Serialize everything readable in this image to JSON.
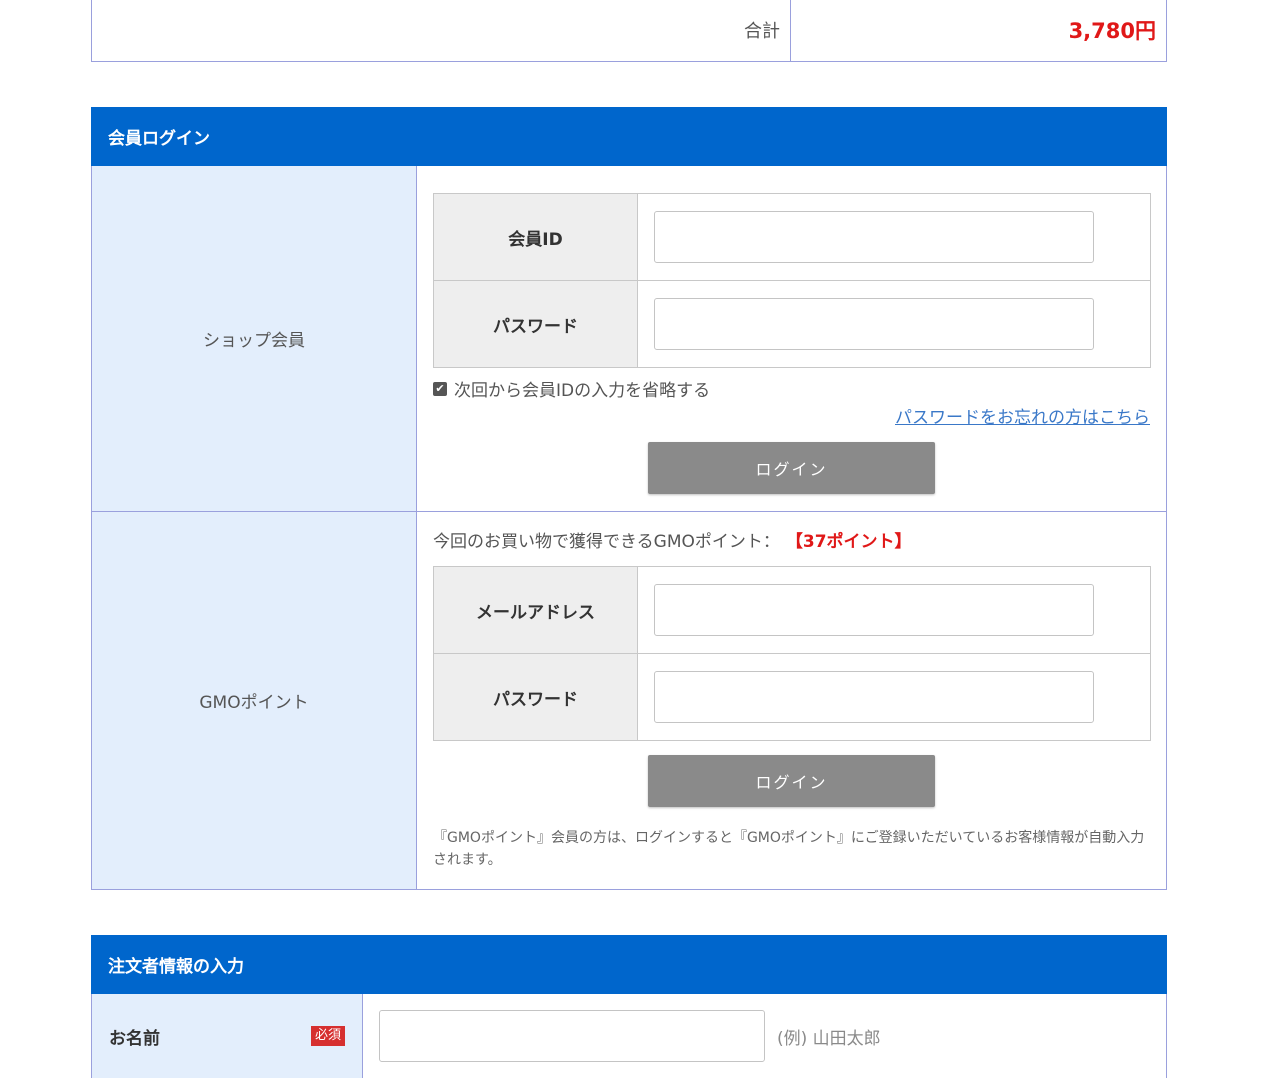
{
  "total": {
    "label": "合計",
    "value": "3,780円"
  },
  "member_login": {
    "header": "会員ログイン",
    "shop_member": {
      "label": "ショップ会員",
      "fields": [
        {
          "label": "会員ID",
          "value": ""
        },
        {
          "label": "パスワード",
          "value": ""
        }
      ],
      "remember_label": "次回から会員IDの入力を省略する",
      "remember_checked": true,
      "forgot_link": "パスワードをお忘れの方はこちら",
      "login_button": "ログイン"
    },
    "gmo_point": {
      "label": "GMOポイント",
      "points_text": "今回のお買い物で獲得できるGMOポイント：",
      "points_value": "【37ポイント】",
      "fields": [
        {
          "label": "メールアドレス",
          "value": ""
        },
        {
          "label": "パスワード",
          "value": ""
        }
      ],
      "login_button": "ログイン",
      "note": "『GMOポイント』会員の方は、ログインすると『GMOポイント』にご登録いただいているお客様情報が自動入力されます。"
    }
  },
  "order_info": {
    "header": "注文者情報の入力",
    "name": {
      "label": "お名前",
      "required_badge": "必須",
      "value": "",
      "example": "(例) 山田太郎"
    }
  },
  "colors": {
    "header_bg": "#0066cc",
    "label_bg": "#e3eefc",
    "accent_red": "#e01818",
    "button_gray": "#8a8a8a",
    "link": "#3a78c8"
  }
}
